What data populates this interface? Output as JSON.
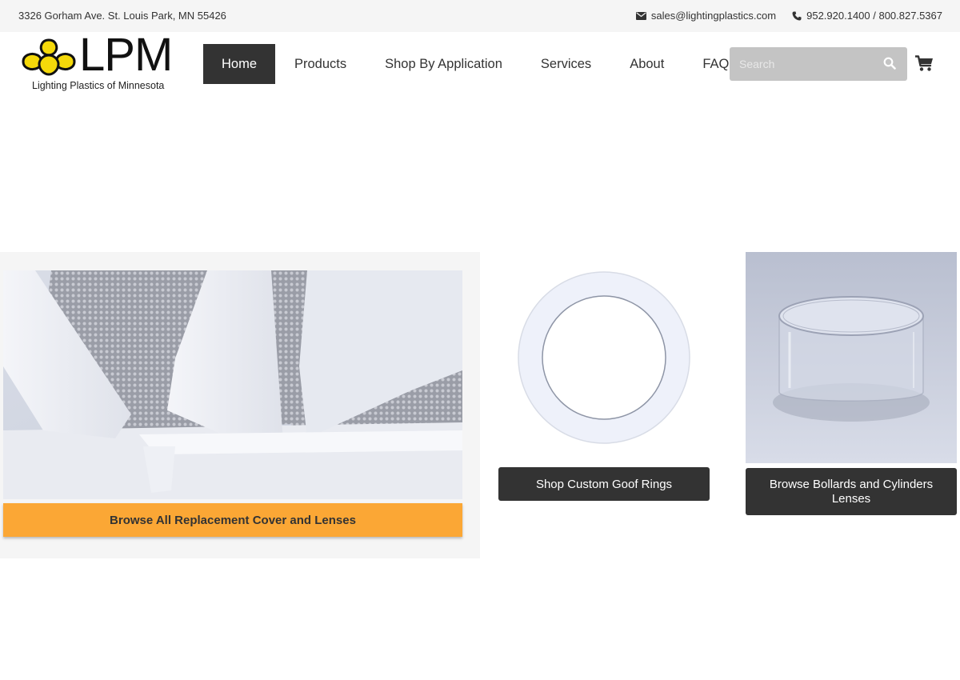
{
  "topbar": {
    "address": "3326 Gorham Ave. St. Louis Park, MN 55426",
    "email": "sales@lightingplastics.com",
    "email_icon": "envelope-icon",
    "phone": "952.920.1400 / 800.827.5367",
    "phone_icon": "phone-icon"
  },
  "logo": {
    "letters": "LPM",
    "tagline": "Lighting Plastics of Minnesota",
    "mark_color": "#f5d90a"
  },
  "nav": {
    "items": [
      {
        "label": "Home",
        "active": true
      },
      {
        "label": "Products"
      },
      {
        "label": "Shop By Application"
      },
      {
        "label": "Services"
      },
      {
        "label": "About"
      },
      {
        "label": "FAQ"
      }
    ]
  },
  "search": {
    "placeholder": "Search",
    "icon": "search-icon"
  },
  "cart": {
    "icon": "cart-icon"
  },
  "features": [
    {
      "label": "Browse All Replacement Cover and Lenses",
      "accent": "#fba735"
    },
    {
      "label": "Shop Custom Goof Rings",
      "accent": "#333333"
    },
    {
      "label": "Browse Bollards and Cylinders Lenses",
      "accent": "#333333"
    }
  ]
}
